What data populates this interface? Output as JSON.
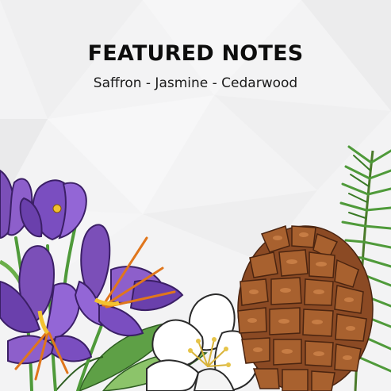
{
  "header": {
    "title": "FEATURED NOTES",
    "subtitle": "Saffron - Jasmine - Cedarwood"
  },
  "illustrations": [
    {
      "name": "saffron-crocus-flowers",
      "color": "#7b4fb8"
    },
    {
      "name": "jasmine-flower",
      "color": "#ffffff"
    },
    {
      "name": "pine-cone",
      "color": "#8b4a24"
    },
    {
      "name": "pine-branch",
      "color": "#3e8a2e"
    }
  ],
  "colors": {
    "background": "#f4f4f5",
    "text": "#0d0d0d",
    "crocus": "#7b4fb8",
    "crocus_dark": "#4a2a82",
    "stigma": "#e0761c",
    "pine_cone": "#a35a2c",
    "leaf": "#4f9a3a"
  }
}
